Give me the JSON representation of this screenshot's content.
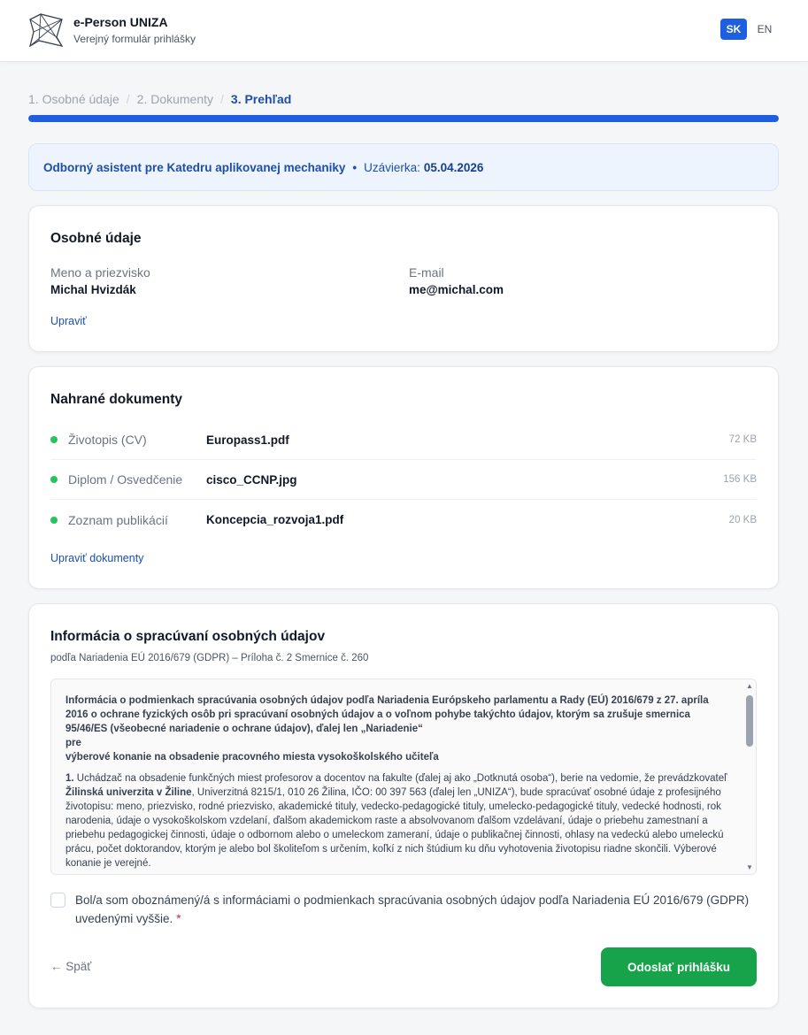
{
  "header": {
    "title": "e-Person UNIZA",
    "subtitle": "Verejný formulár prihlášky",
    "languages": [
      "SK",
      "EN"
    ],
    "active_language": "SK"
  },
  "steps": {
    "items": [
      "1. Osobné údaje",
      "2. Dokumenty",
      "3. Prehľad"
    ],
    "active_index": 2,
    "progress_percent": 100
  },
  "position": {
    "title": "Odborný asistent pre Katedru aplikovanej mechaniky",
    "deadline_label": "Uzávierka:",
    "deadline": "05.04.2026"
  },
  "personal": {
    "title": "Osobné údaje",
    "name_label": "Meno a priezvisko",
    "name_value": "Michal Hvizdák",
    "email_label": "E-mail",
    "email_value": "me@michal.com",
    "edit_label": "Upraviť"
  },
  "documents": {
    "title": "Nahrané dokumenty",
    "items": [
      {
        "type": "Životopis (CV)",
        "file": "Europass1.pdf",
        "size": "72 KB"
      },
      {
        "type": "Diplom / Osvedčenie",
        "file": "cisco_CCNP.jpg",
        "size": "156 KB"
      },
      {
        "type": "Zoznam publikácií",
        "file": "Koncepcia_rozvoja1.pdf",
        "size": "20 KB"
      }
    ],
    "edit_label": "Upraviť dokumenty"
  },
  "gdpr": {
    "title": "Informácia o spracúvaní osobných údajov",
    "subtitle": "podľa Nariadenia EÚ 2016/679 (GDPR) – Príloha č. 2 Smernice č. 260",
    "heading_1": "Informácia o podmienkach spracúvania osobných údajov podľa Nariadenia Európskeho parlamentu a Rady (EÚ) 2016/679 z 27. apríla 2016 o ochrane fyzických osôb pri spracúvaní osobných údajov a o voľnom pohybe takýchto údajov, ktorým sa zrušuje smernica 95/46/ES (všeobecné nariadenie o ochrane údajov), ďalej len „Nariadenie“",
    "heading_2": "pre",
    "heading_3": "výberové konanie na obsadenie pracovného miesta vysokoškolského učiteľa",
    "para_num": "1.",
    "para_a": " Uchádzač na obsadenie funkčných miest profesorov a docentov na fakulte (ďalej aj ako „Dotknutá osoba“), berie na vedomie, že prevádzkovateľ ",
    "para_bold": "Žilinská univerzita v Žiline",
    "para_b": ", Univerzitná 8215/1, 010 26 Žilina, IČO: 00 397 563 (ďalej len „UNIZA“), bude spracúvať osobné údaje z profesijného životopisu: meno, priezvisko, rodné priezvisko, akademické tituly, vedecko-pedagogické tituly, umelecko-pedagogické tituly, vedecké hodnosti, rok narodenia, údaje o vysokoškolskom vzdelaní, ďalšom akademickom raste a absolvovanom ďalšom vzdelávaní, údaje o priebehu zamestnaní a priebehu pedagogickej činnosti, údaje o odbornom alebo o umeleckom zameraní, údaje o publikačnej činnosti, ohlasy na vedeckú alebo umeleckú prácu, počet doktorandov, ktorým je alebo bol školiteľom s určením, koľkí z nich štúdium ku dňu vyhotovenia životopisu riadne skončili. Výberové konanie je verejné.",
    "consent_text": "Bol/a som oboznámený/á s informáciami o podmienkach spracúvania osobných údajov podľa Nariadenia EÚ 2016/679 (GDPR) uvedenými vyššie.",
    "required_mark": "*"
  },
  "actions": {
    "back_label": "← Späť",
    "submit_label": "Odoslať prihlášku"
  },
  "colors": {
    "primary": "#1d5fe0",
    "success": "#16a34a",
    "doc_status": "#22c55e"
  }
}
